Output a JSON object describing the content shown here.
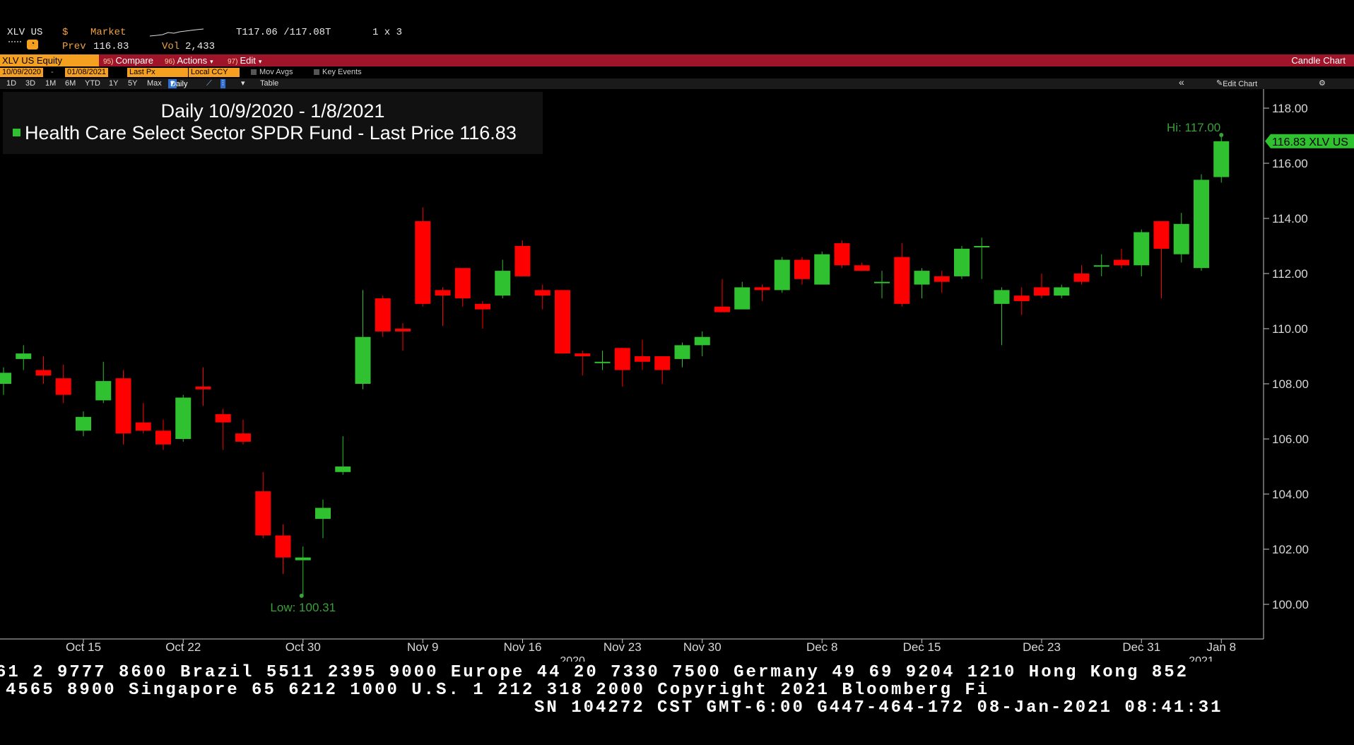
{
  "header": {
    "ticker": "XLV US",
    "currency": "$",
    "market_label": "Market",
    "prev_label": "Prev",
    "prev_value": "116.83",
    "vol_label": "Vol",
    "vol_value": "2,433",
    "bid_ask": "T117.06 /117.08T",
    "size": "1 x 3"
  },
  "toolbar": {
    "security": "XLV US Equity",
    "compare_num": "95)",
    "compare": "Compare",
    "actions_num": "96)",
    "actions": "Actions",
    "edit_num": "97)",
    "edit": "Edit",
    "chart_type": "Candle Chart"
  },
  "options": {
    "start_date": "10/09/2020",
    "end_date": "01/08/2021",
    "price_field": "Last Px",
    "currency_field": "Local CCY",
    "mov_avgs": "Mov Avgs",
    "key_events": "Key Events"
  },
  "periods": {
    "items": [
      "1D",
      "3D",
      "1M",
      "6M",
      "YTD",
      "1Y",
      "5Y",
      "Max"
    ],
    "selected": "Daily",
    "table": "Table",
    "edit_chart": "Edit Chart"
  },
  "legend": {
    "title": "Daily 10/9/2020 - 1/8/2021",
    "series": "Health Care Select Sector SPDR Fund - Last Price 116.83"
  },
  "chart_data": {
    "type": "candlestick",
    "ylim": [
      99.3,
      118.5
    ],
    "yticks": [
      "118.00",
      "116.00",
      "114.00",
      "112.00",
      "110.00",
      "108.00",
      "106.00",
      "104.00",
      "102.00",
      "100.00"
    ],
    "last_label": "116.83 XLV US",
    "hi_label": "Hi: 117.00",
    "low_label": "Low: 100.31",
    "xtick_labels": [
      {
        "label": "Oct 15",
        "index": 4
      },
      {
        "label": "Oct 22",
        "index": 9
      },
      {
        "label": "Oct 30",
        "index": 15
      },
      {
        "label": "Nov 9",
        "index": 21
      },
      {
        "label": "Nov 16",
        "index": 26
      },
      {
        "label": "Nov 23",
        "index": 31
      },
      {
        "label": "Nov 30",
        "index": 35
      },
      {
        "label": "Dec 8",
        "index": 41
      },
      {
        "label": "Dec 15",
        "index": 46
      },
      {
        "label": "Dec 23",
        "index": 52
      },
      {
        "label": "Dec 31",
        "index": 57
      },
      {
        "label": "Jan 8",
        "index": 61
      }
    ],
    "year_labels": [
      {
        "label": "2020",
        "index": 28.5
      },
      {
        "label": "2021",
        "index": 60
      }
    ],
    "candles": [
      {
        "date": "10/9/2020",
        "open": 108.0,
        "high": 108.6,
        "low": 107.6,
        "close": 108.4
      },
      {
        "date": "10/12/2020",
        "open": 108.9,
        "high": 109.4,
        "low": 108.5,
        "close": 109.1
      },
      {
        "date": "10/13/2020",
        "open": 108.5,
        "high": 109.0,
        "low": 108.0,
        "close": 108.3
      },
      {
        "date": "10/14/2020",
        "open": 108.2,
        "high": 108.7,
        "low": 107.3,
        "close": 107.6
      },
      {
        "date": "10/15/2020",
        "open": 106.3,
        "high": 107.0,
        "low": 106.1,
        "close": 106.8
      },
      {
        "date": "10/16/2020",
        "open": 107.4,
        "high": 108.8,
        "low": 107.3,
        "close": 108.1
      },
      {
        "date": "10/19/2020",
        "open": 108.2,
        "high": 108.5,
        "low": 105.8,
        "close": 106.2
      },
      {
        "date": "10/20/2020",
        "open": 106.6,
        "high": 107.3,
        "low": 106.2,
        "close": 106.3
      },
      {
        "date": "10/21/2020",
        "open": 106.3,
        "high": 106.7,
        "low": 105.6,
        "close": 105.8
      },
      {
        "date": "10/22/2020",
        "open": 106.0,
        "high": 107.6,
        "low": 105.9,
        "close": 107.5
      },
      {
        "date": "10/23/2020",
        "open": 107.9,
        "high": 108.6,
        "low": 107.2,
        "close": 107.8
      },
      {
        "date": "10/26/2020",
        "open": 106.9,
        "high": 107.1,
        "low": 105.6,
        "close": 106.6
      },
      {
        "date": "10/27/2020",
        "open": 106.2,
        "high": 106.7,
        "low": 105.8,
        "close": 105.9
      },
      {
        "date": "10/28/2020",
        "open": 104.1,
        "high": 104.8,
        "low": 102.4,
        "close": 102.5
      },
      {
        "date": "10/29/2020",
        "open": 102.5,
        "high": 102.9,
        "low": 101.1,
        "close": 101.7
      },
      {
        "date": "10/30/2020",
        "open": 101.6,
        "high": 102.1,
        "low": 100.31,
        "close": 101.7
      },
      {
        "date": "11/2/2020",
        "open": 103.1,
        "high": 103.8,
        "low": 102.4,
        "close": 103.5
      },
      {
        "date": "11/3/2020",
        "open": 104.8,
        "high": 106.1,
        "low": 104.7,
        "close": 105.0
      },
      {
        "date": "11/4/2020",
        "open": 108.0,
        "high": 111.4,
        "low": 107.8,
        "close": 109.7
      },
      {
        "date": "11/5/2020",
        "open": 111.1,
        "high": 111.2,
        "low": 109.7,
        "close": 109.9
      },
      {
        "date": "11/6/2020",
        "open": 110.0,
        "high": 110.2,
        "low": 109.2,
        "close": 109.9
      },
      {
        "date": "11/9/2020",
        "open": 113.9,
        "high": 114.4,
        "low": 110.8,
        "close": 110.9
      },
      {
        "date": "11/10/2020",
        "open": 111.4,
        "high": 111.5,
        "low": 110.1,
        "close": 111.2
      },
      {
        "date": "11/11/2020",
        "open": 112.2,
        "high": 112.2,
        "low": 110.8,
        "close": 111.1
      },
      {
        "date": "11/12/2020",
        "open": 110.9,
        "high": 111.0,
        "low": 110.0,
        "close": 110.7
      },
      {
        "date": "11/13/2020",
        "open": 111.2,
        "high": 112.5,
        "low": 111.1,
        "close": 112.1
      },
      {
        "date": "11/16/2020",
        "open": 113.0,
        "high": 113.2,
        "low": 111.9,
        "close": 111.9
      },
      {
        "date": "11/17/2020",
        "open": 111.4,
        "high": 111.6,
        "low": 110.7,
        "close": 111.2
      },
      {
        "date": "11/18/2020",
        "open": 111.4,
        "high": 111.4,
        "low": 109.1,
        "close": 109.1
      },
      {
        "date": "11/19/2020",
        "open": 109.1,
        "high": 109.2,
        "low": 108.3,
        "close": 109.0
      },
      {
        "date": "11/20/2020",
        "open": 108.8,
        "high": 109.2,
        "low": 108.5,
        "close": 108.8
      },
      {
        "date": "11/23/2020",
        "open": 109.3,
        "high": 109.3,
        "low": 107.9,
        "close": 108.5
      },
      {
        "date": "11/24/2020",
        "open": 109.0,
        "high": 109.6,
        "low": 108.5,
        "close": 108.8
      },
      {
        "date": "11/25/2020",
        "open": 109.0,
        "high": 109.0,
        "low": 108.0,
        "close": 108.5
      },
      {
        "date": "11/27/2020",
        "open": 108.9,
        "high": 109.5,
        "low": 108.6,
        "close": 109.4
      },
      {
        "date": "11/30/2020",
        "open": 109.4,
        "high": 109.9,
        "low": 109.0,
        "close": 109.7
      },
      {
        "date": "12/1/2020",
        "open": 110.8,
        "high": 111.8,
        "low": 110.6,
        "close": 110.6
      },
      {
        "date": "12/2/2020",
        "open": 110.7,
        "high": 111.7,
        "low": 110.7,
        "close": 111.5
      },
      {
        "date": "12/3/2020",
        "open": 111.5,
        "high": 111.6,
        "low": 111.0,
        "close": 111.4
      },
      {
        "date": "12/4/2020",
        "open": 111.4,
        "high": 112.6,
        "low": 111.3,
        "close": 112.5
      },
      {
        "date": "12/7/2020",
        "open": 112.5,
        "high": 112.6,
        "low": 111.6,
        "close": 111.8
      },
      {
        "date": "12/8/2020",
        "open": 111.6,
        "high": 112.8,
        "low": 111.6,
        "close": 112.7
      },
      {
        "date": "12/9/2020",
        "open": 113.1,
        "high": 113.2,
        "low": 112.2,
        "close": 112.3
      },
      {
        "date": "12/10/2020",
        "open": 112.3,
        "high": 112.4,
        "low": 112.1,
        "close": 112.1
      },
      {
        "date": "12/11/2020",
        "open": 111.7,
        "high": 112.1,
        "low": 111.1,
        "close": 111.7
      },
      {
        "date": "12/14/2020",
        "open": 112.6,
        "high": 113.1,
        "low": 110.8,
        "close": 110.9
      },
      {
        "date": "12/15/2020",
        "open": 111.6,
        "high": 112.2,
        "low": 111.1,
        "close": 112.1
      },
      {
        "date": "12/16/2020",
        "open": 111.9,
        "high": 112.1,
        "low": 111.3,
        "close": 111.7
      },
      {
        "date": "12/17/2020",
        "open": 111.9,
        "high": 113.0,
        "low": 111.8,
        "close": 112.9
      },
      {
        "date": "12/18/2020",
        "open": 113.0,
        "high": 113.3,
        "low": 111.8,
        "close": 113.0
      },
      {
        "date": "12/21/2020",
        "open": 110.9,
        "high": 111.5,
        "low": 109.4,
        "close": 111.4
      },
      {
        "date": "12/22/2020",
        "open": 111.2,
        "high": 111.5,
        "low": 110.5,
        "close": 111.0
      },
      {
        "date": "12/23/2020",
        "open": 111.5,
        "high": 112.0,
        "low": 111.1,
        "close": 111.2
      },
      {
        "date": "12/24/2020",
        "open": 111.2,
        "high": 111.6,
        "low": 111.1,
        "close": 111.5
      },
      {
        "date": "12/28/2020",
        "open": 112.0,
        "high": 112.3,
        "low": 111.6,
        "close": 111.7
      },
      {
        "date": "12/29/2020",
        "open": 112.3,
        "high": 112.7,
        "low": 111.9,
        "close": 112.3
      },
      {
        "date": "12/30/2020",
        "open": 112.5,
        "high": 112.9,
        "low": 112.2,
        "close": 112.3
      },
      {
        "date": "12/31/2020",
        "open": 112.3,
        "high": 113.6,
        "low": 111.9,
        "close": 113.5
      },
      {
        "date": "1/4/2021",
        "open": 113.9,
        "high": 113.9,
        "low": 111.1,
        "close": 112.9
      },
      {
        "date": "1/5/2021",
        "open": 112.7,
        "high": 114.2,
        "low": 112.4,
        "close": 113.8
      },
      {
        "date": "1/6/2021",
        "open": 112.2,
        "high": 115.6,
        "low": 112.1,
        "close": 115.4
      },
      {
        "date": "1/7/2021",
        "open": 115.5,
        "high": 117.0,
        "low": 115.3,
        "close": 116.8
      }
    ],
    "colors": {
      "up": "#2fc12f",
      "down": "#ff0000",
      "axis": "#c8c8c8",
      "label_green": "#3aa03a",
      "background": "#000000"
    }
  },
  "footer": {
    "line1": "61 2 9777 8600 Brazil 5511 2395 9000 Europe 44 20 7330 7500 Germany 49 69 9204 1210 Hong Kong 852",
    "line2": "4565 8900      Singapore 65 6212 1000      U.S. 1 212 318 2000      Copyright 2021 Bloomberg Fi",
    "line3": "SN 104272 CST  GMT-6:00 G447-464-172 08-Jan-2021 08:41:31"
  }
}
